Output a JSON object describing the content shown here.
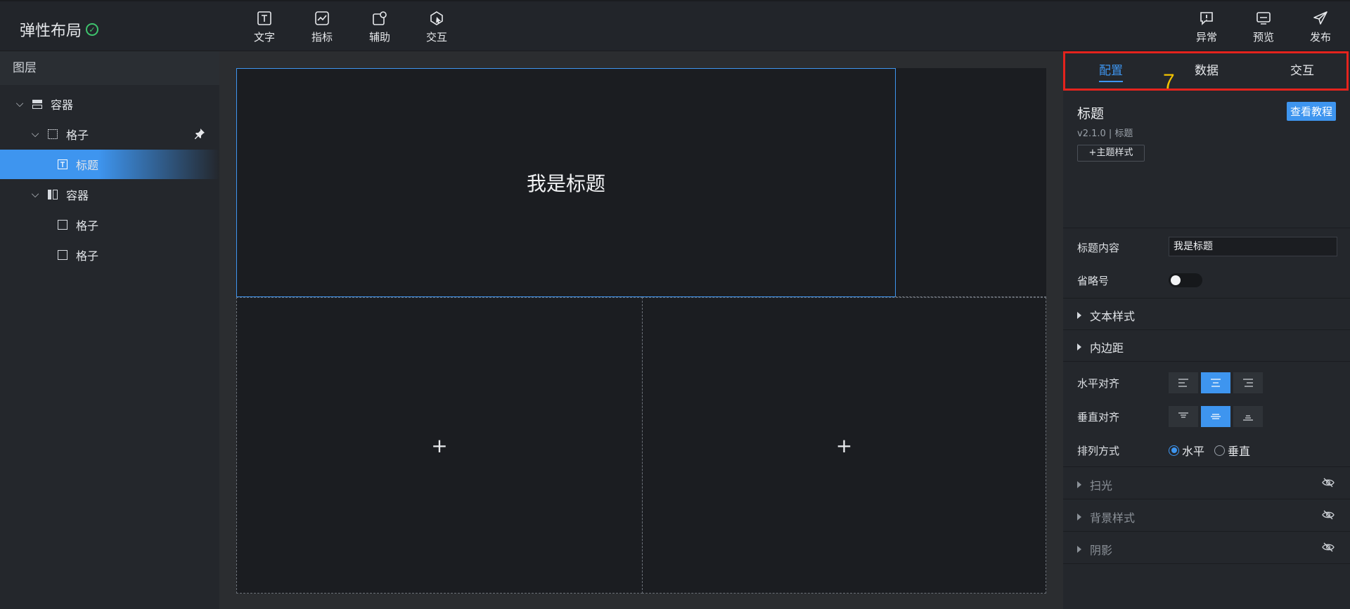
{
  "app": {
    "title": "弹性布局"
  },
  "toolbar": {
    "tools": [
      {
        "label": "文字",
        "icon": "text-icon"
      },
      {
        "label": "指标",
        "icon": "chart-icon"
      },
      {
        "label": "辅助",
        "icon": "tag-icon"
      },
      {
        "label": "交互",
        "icon": "pointer-icon"
      }
    ],
    "actions": [
      {
        "label": "异常",
        "icon": "alert-icon"
      },
      {
        "label": "预览",
        "icon": "preview-icon"
      },
      {
        "label": "发布",
        "icon": "send-icon"
      }
    ]
  },
  "layers": {
    "header": "图层",
    "items": [
      {
        "label": "容器",
        "icon": "container-icon"
      },
      {
        "label": "格子",
        "icon": "cell-icon"
      },
      {
        "label": "标题",
        "icon": "text-icon"
      },
      {
        "label": "容器",
        "icon": "columns-icon"
      },
      {
        "label": "格子",
        "icon": "cell-icon"
      },
      {
        "label": "格子",
        "icon": "cell-icon"
      }
    ]
  },
  "canvas": {
    "title_text": "我是标题",
    "add_symbol": "+"
  },
  "panel": {
    "tabs": [
      "配置",
      "数据",
      "交互"
    ],
    "marker": "7",
    "component_title": "标题",
    "tutorial_button": "查看教程",
    "version": "v2.1.0 | 标题",
    "theme_button": "+主题样式",
    "props": {
      "content_label": "标题内容",
      "content_value": "我是标题",
      "ellipsis_label": "省略号"
    },
    "groups": {
      "text_style": "文本样式",
      "padding": "内边距"
    },
    "align": {
      "h_label": "水平对齐",
      "v_label": "垂直对齐",
      "arrange_label": "排列方式",
      "horizontal": "水平",
      "vertical": "垂直"
    },
    "hidden_groups": {
      "scan": "扫光",
      "bg": "背景样式",
      "shadow": "阴影"
    }
  },
  "colors": {
    "accent": "#3e95ef",
    "highlight_border": "#e4231d",
    "marker": "#f2c200",
    "success": "#3ec46d"
  }
}
